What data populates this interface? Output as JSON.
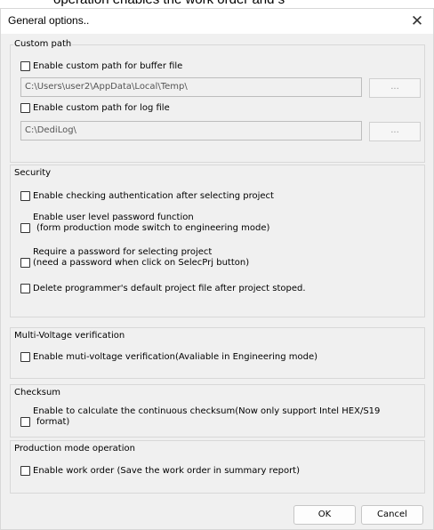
{
  "background_caption": "operation enables the work order and s",
  "dialog": {
    "title": "General options..",
    "close_glyph": "✕"
  },
  "custom_path": {
    "label": "Custom path",
    "buffer_checkbox": {
      "label": "Enable custom path for buffer file",
      "checked": false
    },
    "buffer_path": "C:\\Users\\user2\\AppData\\Local\\Temp\\",
    "buffer_browse_label": "...",
    "log_checkbox": {
      "label": "Enable custom path for log file",
      "checked": false
    },
    "log_path": "C:\\DediLog\\",
    "log_browse_label": "..."
  },
  "security": {
    "label": "Security",
    "items": [
      {
        "label": "Enable checking authentication after selecting project",
        "checked": false
      },
      {
        "line1": "Enable user level password function",
        "line2": "(form production mode switch to engineering mode)",
        "checked": false
      },
      {
        "line1": "Require a password for selecting project",
        "line2": "(need a password when click on SelecPrj button)",
        "checked": false
      },
      {
        "label": "Delete programmer's default  project file after project stoped.",
        "checked": false
      }
    ]
  },
  "multi_voltage": {
    "label": "Multi-Voltage verification",
    "checkbox": "Enable muti-voltage verification(Avaliable in Engineering mode)"
  },
  "checksum": {
    "label": "Checksum",
    "line1": "Enable to calculate the continuous checksum(Now only support Intel HEX/S19",
    "line2": "format)"
  },
  "production": {
    "label": "Production mode operation",
    "checkbox": "Enable work order (Save the work order in summary report)"
  },
  "buttons": {
    "ok": "OK",
    "cancel": "Cancel"
  }
}
